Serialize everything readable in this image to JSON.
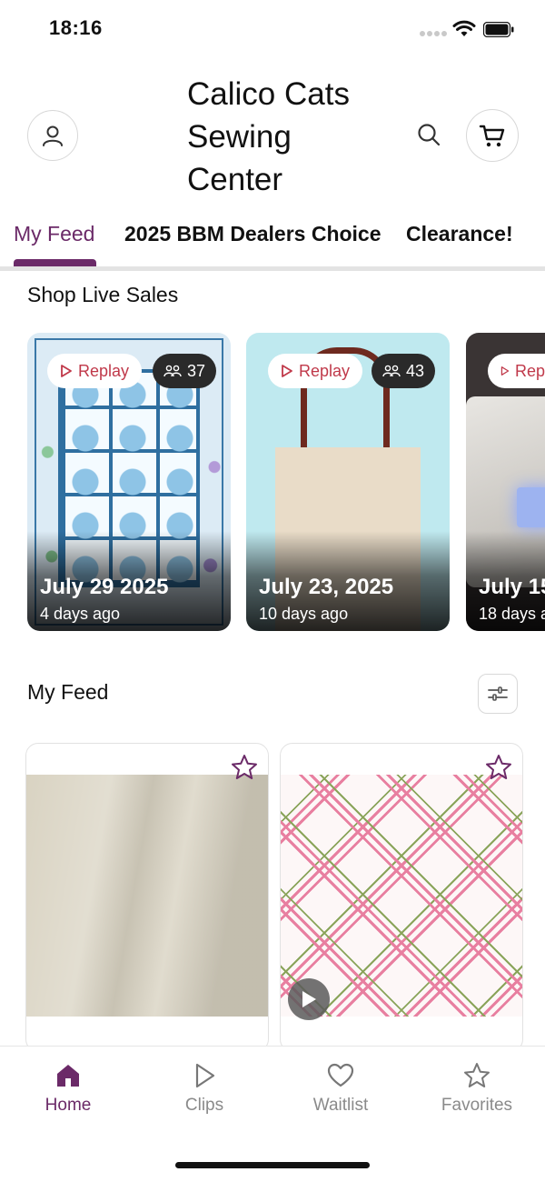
{
  "status_bar": {
    "time": "18:16"
  },
  "header": {
    "store_name_lines": [
      "Calico Cats",
      "Sewing",
      "Center"
    ],
    "account_icon": "person-icon",
    "search_icon": "search-icon",
    "cart_icon": "cart-icon"
  },
  "tabs": [
    {
      "label": "My Feed",
      "active": true
    },
    {
      "label": "2025 BBM Dealers Choice",
      "active": false
    },
    {
      "label": "Clearance!",
      "active": false
    }
  ],
  "live_sales": {
    "title": "Shop Live Sales",
    "cards": [
      {
        "replay_label": "Replay",
        "viewers": "37",
        "date": "July 29 2025",
        "ago": "4 days ago"
      },
      {
        "replay_label": "Replay",
        "viewers": "43",
        "date": "July 23, 2025",
        "ago": "10 days ago"
      },
      {
        "replay_label": "Rep",
        "date": "July 15",
        "ago": "18 days a"
      }
    ]
  },
  "feed": {
    "title": "My Feed",
    "filter_icon": "sliders-icon"
  },
  "bottom_nav": [
    {
      "label": "Home",
      "icon": "home-icon",
      "active": true
    },
    {
      "label": "Clips",
      "icon": "play-icon",
      "active": false
    },
    {
      "label": "Waitlist",
      "icon": "heart-icon",
      "active": false
    },
    {
      "label": "Favorites",
      "icon": "star-icon",
      "active": false
    }
  ],
  "colors": {
    "accent": "#6b2a68",
    "replay_red": "#c0394a"
  }
}
